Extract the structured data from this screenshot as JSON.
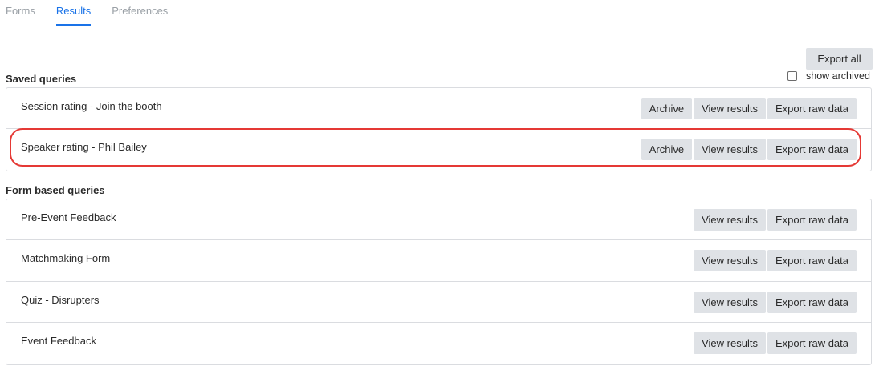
{
  "tabs": [
    {
      "label": "Forms"
    },
    {
      "label": "Results"
    },
    {
      "label": "Preferences"
    }
  ],
  "export_all_label": "Export all",
  "show_archived_label": "show archived",
  "saved_queries": {
    "title": "Saved queries",
    "rows": [
      {
        "label": "Session rating - Join the booth",
        "archive": "Archive",
        "view": "View results",
        "export": "Export raw data"
      },
      {
        "label": "Speaker rating - Phil Bailey",
        "archive": "Archive",
        "view": "View results",
        "export": "Export raw data"
      }
    ]
  },
  "form_queries": {
    "title": "Form based queries",
    "rows": [
      {
        "label": "Pre-Event Feedback",
        "view": "View results",
        "export": "Export raw data"
      },
      {
        "label": "Matchmaking Form",
        "view": "View results",
        "export": "Export raw data"
      },
      {
        "label": "Quiz - Disrupters",
        "view": "View results",
        "export": "Export raw data"
      },
      {
        "label": "Event Feedback",
        "view": "View results",
        "export": "Export raw data"
      }
    ]
  },
  "colors": {
    "accent": "#1a73e8",
    "highlight": "#e53935",
    "button_bg": "#dfe2e6"
  }
}
